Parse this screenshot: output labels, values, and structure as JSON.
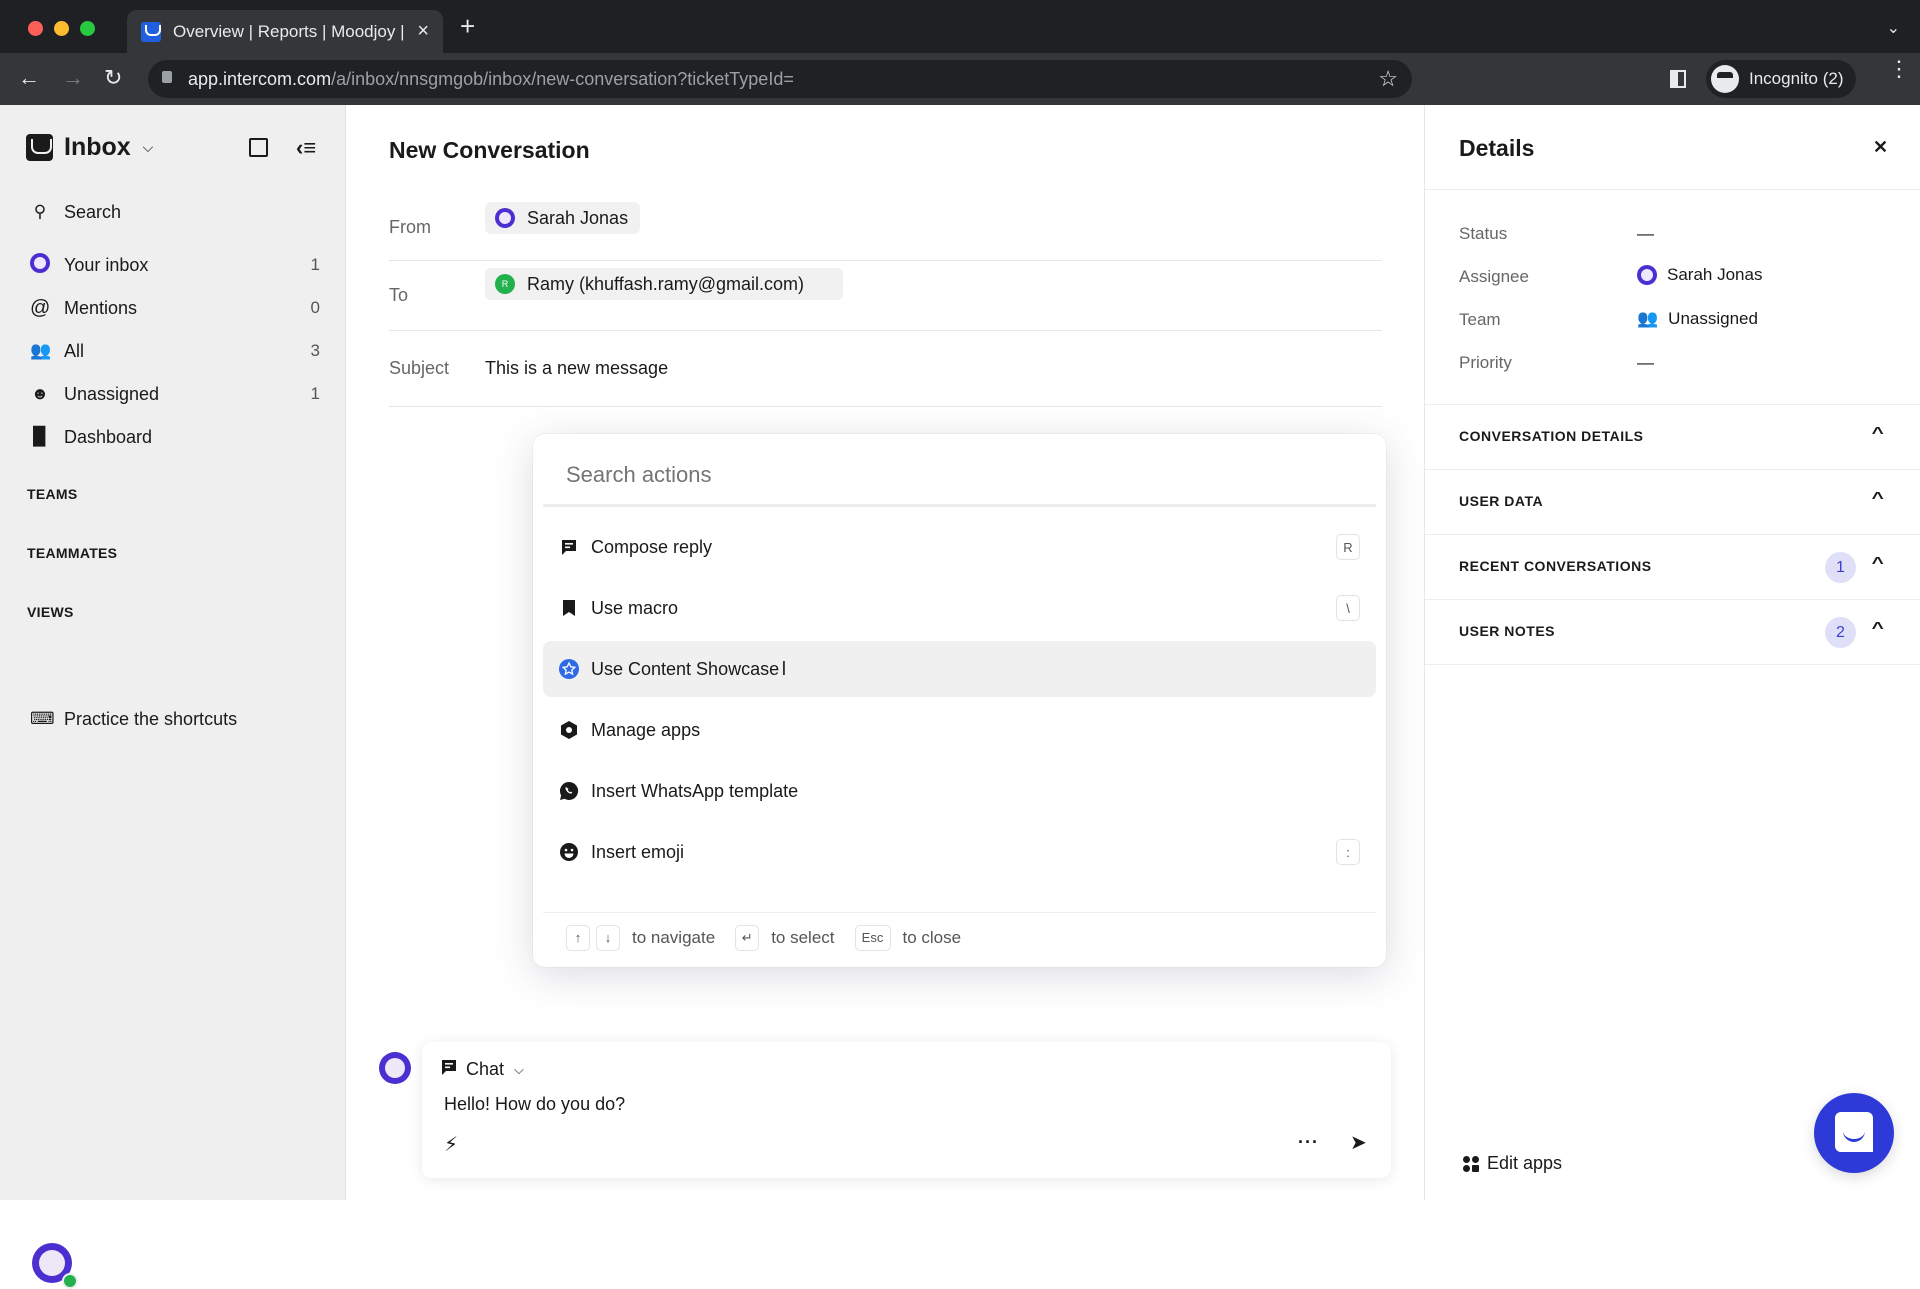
{
  "browser": {
    "tab_title": "Overview | Reports | Moodjoy |",
    "tab_close": "×",
    "new_tab": "+",
    "url_host": "app.intercom.com",
    "url_path": "/a/inbox/nnsgmgob/inbox/new-conversation?ticketTypeId=",
    "profile_label": "Incognito (2)",
    "traffic_colors": [
      "#fe5f57",
      "#febc2e",
      "#28c840"
    ]
  },
  "sidebar": {
    "title": "Inbox",
    "search_label": "Search",
    "items": [
      {
        "label": "Your inbox",
        "count": "1",
        "icon": "your-inbox-avatar-icon"
      },
      {
        "label": "Mentions",
        "count": "0",
        "icon": "at-icon"
      },
      {
        "label": "All",
        "count": "3",
        "icon": "people-icon"
      },
      {
        "label": "Unassigned",
        "count": "1",
        "icon": "unassigned-icon"
      },
      {
        "label": "Dashboard",
        "count": "",
        "icon": "bar-chart-icon"
      }
    ],
    "sections": [
      "TEAMS",
      "TEAMMATES",
      "VIEWS"
    ],
    "practice_label": "Practice the shortcuts"
  },
  "conversation": {
    "title": "New Conversation",
    "from_label": "From",
    "from_value": "Sarah Jonas",
    "to_label": "To",
    "to_value": "Ramy (khuffash.ramy@gmail.com)",
    "to_avatar_initial": "R",
    "subject_label": "Subject",
    "subject_value": "This is a new message"
  },
  "palette": {
    "search_placeholder": "Search actions",
    "items": [
      {
        "label": "Compose reply",
        "shortcut": "R",
        "icon": "compose-reply-icon"
      },
      {
        "label": "Use macro",
        "shortcut": "\\",
        "icon": "bookmark-icon"
      },
      {
        "label": "Use Content Showcase",
        "shortcut": "",
        "icon": "star-badge-icon",
        "selected": true
      },
      {
        "label": "Manage apps",
        "shortcut": "",
        "icon": "hexagon-icon"
      },
      {
        "label": "Insert WhatsApp template",
        "shortcut": "",
        "icon": "whatsapp-icon"
      },
      {
        "label": "Insert emoji",
        "shortcut": ":",
        "icon": "emoji-icon"
      }
    ],
    "footer": {
      "up_key": "↑",
      "down_key": "↓",
      "navigate": "to navigate",
      "enter_key": "↵",
      "select": "to select",
      "esc_key": "Esc",
      "close": "to close"
    }
  },
  "composer": {
    "type_label": "Chat",
    "message": "Hello! How do you do?"
  },
  "details": {
    "title": "Details",
    "fields": [
      {
        "label": "Status",
        "value": "—"
      },
      {
        "label": "Assignee",
        "value": "Sarah Jonas"
      },
      {
        "label": "Team",
        "value": "Unassigned"
      },
      {
        "label": "Priority",
        "value": "—"
      }
    ],
    "sections": [
      {
        "label": "CONVERSATION DETAILS",
        "badge": ""
      },
      {
        "label": "USER DATA",
        "badge": ""
      },
      {
        "label": "RECENT CONVERSATIONS",
        "badge": "1"
      },
      {
        "label": "USER NOTES",
        "badge": "2"
      }
    ],
    "edit_apps_label": "Edit apps"
  },
  "colors": {
    "brand_blue": "#2e3ad8",
    "avatar_purple": "#4b2fd0",
    "online_green": "#22b14c",
    "badge_bg": "#dfe0f7"
  }
}
